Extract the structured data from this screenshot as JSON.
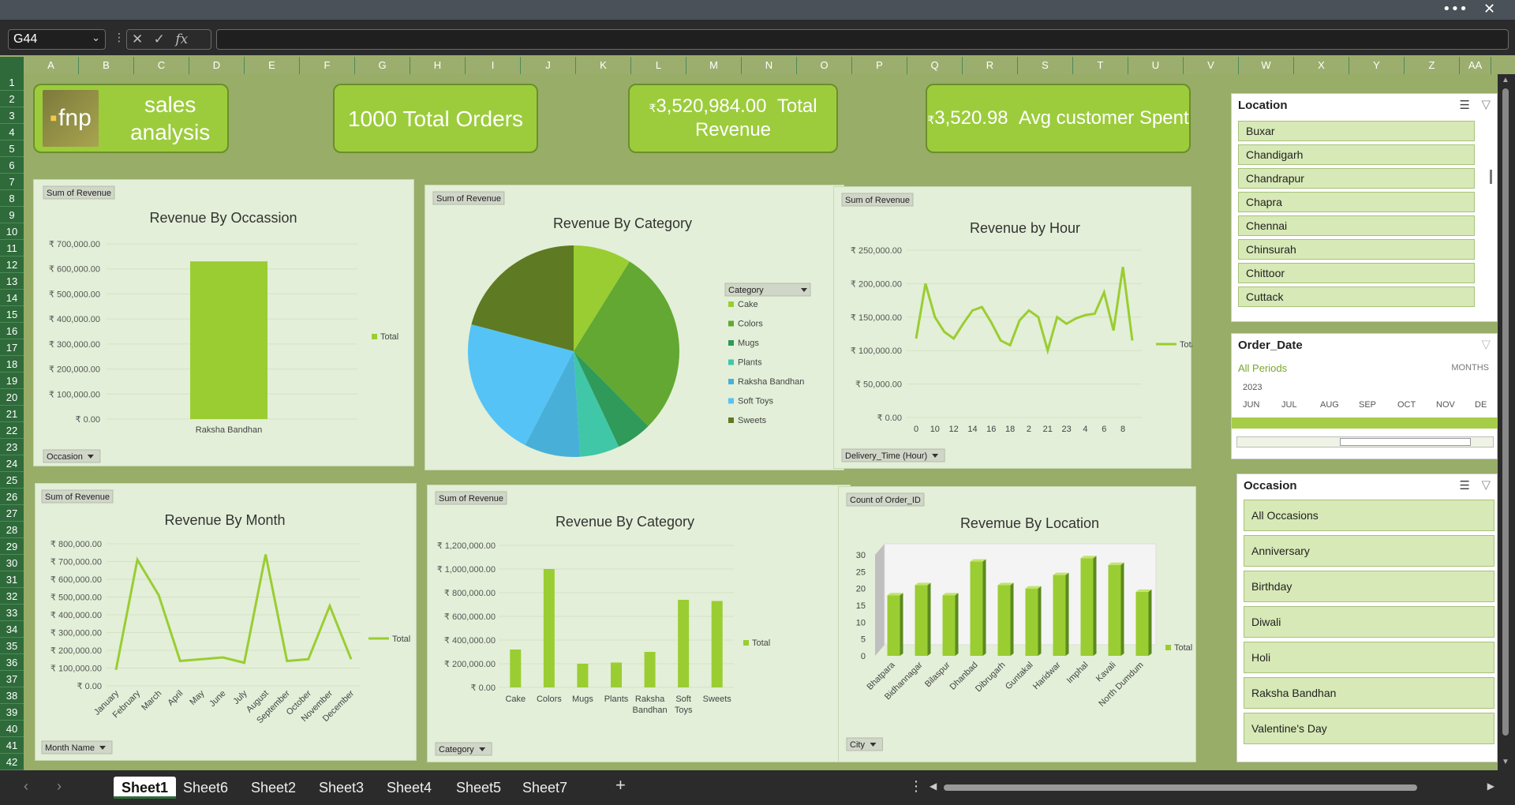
{
  "window": {
    "more": "•••",
    "close": "✕"
  },
  "formula_bar": {
    "name_box": "G44",
    "fx_label": "fx",
    "value": ""
  },
  "columns": [
    "A",
    "B",
    "C",
    "D",
    "E",
    "F",
    "G",
    "H",
    "I",
    "J",
    "K",
    "L",
    "M",
    "N",
    "O",
    "P",
    "Q",
    "R",
    "S",
    "T",
    "U",
    "V",
    "W",
    "X",
    "Y",
    "Z",
    "AA"
  ],
  "rows": [
    "1",
    "2",
    "3",
    "4",
    "5",
    "6",
    "7",
    "8",
    "9",
    "10",
    "11",
    "12",
    "13",
    "14",
    "15",
    "16",
    "17",
    "18",
    "19",
    "20",
    "21",
    "22",
    "23",
    "24",
    "25",
    "26",
    "27",
    "28",
    "29",
    "30",
    "31",
    "32",
    "33",
    "34",
    "35",
    "36",
    "37",
    "38",
    "39",
    "40",
    "41",
    "42"
  ],
  "kpis": {
    "title": "sales analysis",
    "logo": "fnp",
    "orders": "1000 Total Orders",
    "revenue_symbol": "₹",
    "revenue_value": "3,520,984.00",
    "revenue_label": "Total Revenue",
    "avg_symbol": "₹",
    "avg_value": "3,520.98",
    "avg_label": "Avg customer Spent"
  },
  "charts": {
    "occasion": {
      "tag": "Sum of Revenue",
      "title": "Revenue By Occassion",
      "legend": "Total",
      "filter": "Occasion",
      "yticks": [
        "₹ 700,000.00",
        "₹ 600,000.00",
        "₹ 500,000.00",
        "₹ 400,000.00",
        "₹ 300,000.00",
        "₹ 200,000.00",
        "₹ 100,000.00",
        "₹ 0.00"
      ],
      "category": "Raksha Bandhan"
    },
    "category_pie": {
      "tag": "Sum of Revenue",
      "title": "Revenue By Category",
      "legend_title": "Category"
    },
    "hour": {
      "tag": "Sum of Revenue",
      "title": "Revenue by Hour",
      "legend": "Total",
      "filter": "Delivery_Time (Hour)",
      "yticks": [
        "₹ 250,000.00",
        "₹ 200,000.00",
        "₹ 150,000.00",
        "₹ 100,000.00",
        "₹ 50,000.00",
        "₹ 0.00"
      ],
      "xticks": [
        "0",
        "10",
        "12",
        "14",
        "16",
        "18",
        "2",
        "21",
        "23",
        "4",
        "6",
        "8"
      ]
    },
    "month": {
      "tag": "Sum of Revenue",
      "title": "Revenue By Month",
      "legend": "Total",
      "filter": "Month Name",
      "yticks": [
        "₹ 800,000.00",
        "₹ 700,000.00",
        "₹ 600,000.00",
        "₹ 500,000.00",
        "₹ 400,000.00",
        "₹ 300,000.00",
        "₹ 200,000.00",
        "₹ 100,000.00",
        "₹ 0.00"
      ]
    },
    "category_bar": {
      "tag": "Sum of Revenue",
      "title": "Revenue By Category",
      "legend": "Total",
      "filter": "Category",
      "yticks": [
        "₹ 1,200,000.00",
        "₹ 1,000,000.00",
        "₹ 800,000.00",
        "₹ 600,000.00",
        "₹ 400,000.00",
        "₹ 200,000.00",
        "₹ 0.00"
      ]
    },
    "location": {
      "tag": "Count of Order_ID",
      "title": "Revemue By Location",
      "legend": "Total",
      "filter": "City",
      "yticks": [
        "30",
        "25",
        "20",
        "15",
        "10",
        "5",
        "0"
      ]
    }
  },
  "chart_data": [
    {
      "type": "bar",
      "title": "Revenue By Occassion",
      "categories": [
        "Raksha Bandhan"
      ],
      "values": [
        630000
      ],
      "ylim": [
        0,
        700000
      ]
    },
    {
      "type": "pie",
      "title": "Revenue By Category",
      "categories": [
        "Cake",
        "Colors",
        "Mugs",
        "Plants",
        "Raksha Bandhan",
        "Soft Toys",
        "Sweets"
      ],
      "values": [
        310000,
        1000000,
        190000,
        210000,
        300000,
        750000,
        730000
      ]
    },
    {
      "type": "line",
      "title": "Revenue by Hour",
      "x": [
        "0",
        "1",
        "10",
        "11",
        "12",
        "13",
        "14",
        "15",
        "16",
        "17",
        "18",
        "19",
        "2",
        "20",
        "21",
        "22",
        "23",
        "3",
        "4",
        "5",
        "6",
        "7",
        "8",
        "9"
      ],
      "values": [
        118000,
        200000,
        150000,
        128000,
        118000,
        140000,
        160000,
        165000,
        142000,
        115000,
        108000,
        145000,
        160000,
        150000,
        100000,
        150000,
        140000,
        148000,
        153000,
        155000,
        187000,
        130000,
        225000,
        115000
      ],
      "ylim": [
        0,
        250000
      ]
    },
    {
      "type": "line",
      "title": "Revenue By Month",
      "categories": [
        "January",
        "February",
        "March",
        "April",
        "May",
        "June",
        "July",
        "August",
        "September",
        "October",
        "November",
        "December"
      ],
      "values": [
        90000,
        710000,
        510000,
        140000,
        150000,
        160000,
        130000,
        740000,
        140000,
        150000,
        450000,
        150000
      ],
      "ylim": [
        0,
        800000
      ]
    },
    {
      "type": "bar",
      "title": "Revenue By Category",
      "categories": [
        "Cake",
        "Colors",
        "Mugs",
        "Plants",
        "Raksha Bandhan",
        "Soft Toys",
        "Sweets"
      ],
      "values": [
        320000,
        1000000,
        200000,
        210000,
        300000,
        740000,
        730000
      ],
      "ylim": [
        0,
        1200000
      ]
    },
    {
      "type": "bar",
      "title": "Revemue By Location",
      "categories": [
        "Bhatpara",
        "Bidhannagar",
        "Bilaspur",
        "Dhanbad",
        "Dibrugarh",
        "Guntakal",
        "Haridwar",
        "Imphal",
        "Kavali",
        "North Dumdum"
      ],
      "values": [
        18,
        21,
        18,
        28,
        21,
        20,
        24,
        29,
        27,
        19
      ],
      "ylim": [
        0,
        30
      ]
    }
  ],
  "colors": {
    "green1": "#9acd32",
    "green2": "#62a832",
    "green3": "#2f9a5a",
    "teal": "#3fc7a7",
    "blue": "#48b0d8",
    "skyblue": "#55c3f5",
    "olive": "#5e7a22"
  },
  "slicers": {
    "location": {
      "title": "Location",
      "items": [
        "Buxar",
        "Chandigarh",
        "Chandrapur",
        "Chapra",
        "Chennai",
        "Chinsurah",
        "Chittoor",
        "Cuttack"
      ]
    },
    "order_date": {
      "title": "Order_Date",
      "all_periods": "All Periods",
      "unit": "MONTHS",
      "year": "2023",
      "months": [
        "JUN",
        "JUL",
        "AUG",
        "SEP",
        "OCT",
        "NOV",
        "DE"
      ]
    },
    "occasion": {
      "title": "Occasion",
      "items": [
        "All Occasions",
        "Anniversary",
        "Birthday",
        "Diwali",
        "Holi",
        "Raksha Bandhan",
        "Valentine's Day"
      ]
    }
  },
  "sheets": [
    "Sheet1",
    "Sheet6",
    "Sheet2",
    "Sheet3",
    "Sheet4",
    "Sheet5",
    "Sheet7"
  ],
  "add_sheet": "+"
}
